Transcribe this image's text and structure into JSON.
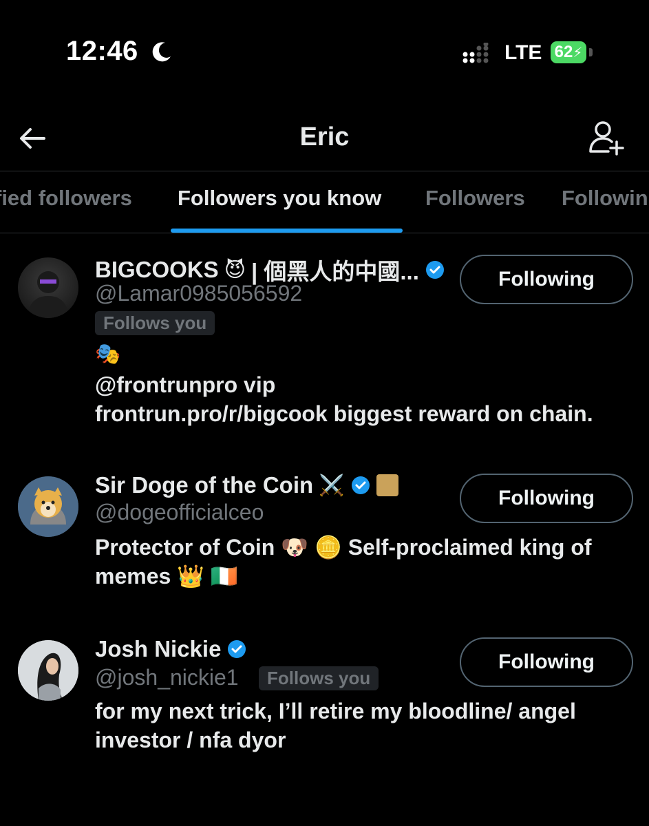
{
  "status_bar": {
    "time": "12:46",
    "network": "LTE",
    "battery": "62",
    "battery_color": "#4cd964"
  },
  "header": {
    "title": "Eric",
    "back_icon": "arrow-left-icon",
    "add_icon": "person-add-icon"
  },
  "tabs": [
    {
      "label": "fied followers",
      "active": false
    },
    {
      "label": "Followers you know",
      "active": true
    },
    {
      "label": "Followers",
      "active": false
    },
    {
      "label": "Followin",
      "active": false
    }
  ],
  "accent_color": "#1d9bf0",
  "users": [
    {
      "name": "BIGCOOKS",
      "name_suffix": "| 個黑人的中國...",
      "handle": "@Lamar0985056592",
      "verified": true,
      "follows_you": "Follows you",
      "bio_lines": [
        "@frontrunpro vip",
        "frontrun.pro/r/bigcook biggest reward on chain."
      ],
      "button": "Following"
    },
    {
      "name": "Sir Doge of the Coin",
      "handle": "@dogeofficialceo",
      "verified": true,
      "bio_lines": [
        "Protector of Coin",
        "Self-proclaimed king of",
        "memes"
      ],
      "button": "Following"
    },
    {
      "name": "Josh Nickie",
      "handle": "@josh_nickie1",
      "verified": true,
      "follows_you": "Follows you",
      "bio_lines": [
        "for my next trick, I’ll retire my bloodline/ angel",
        "investor / nfa dyor"
      ],
      "button": "Following"
    }
  ]
}
